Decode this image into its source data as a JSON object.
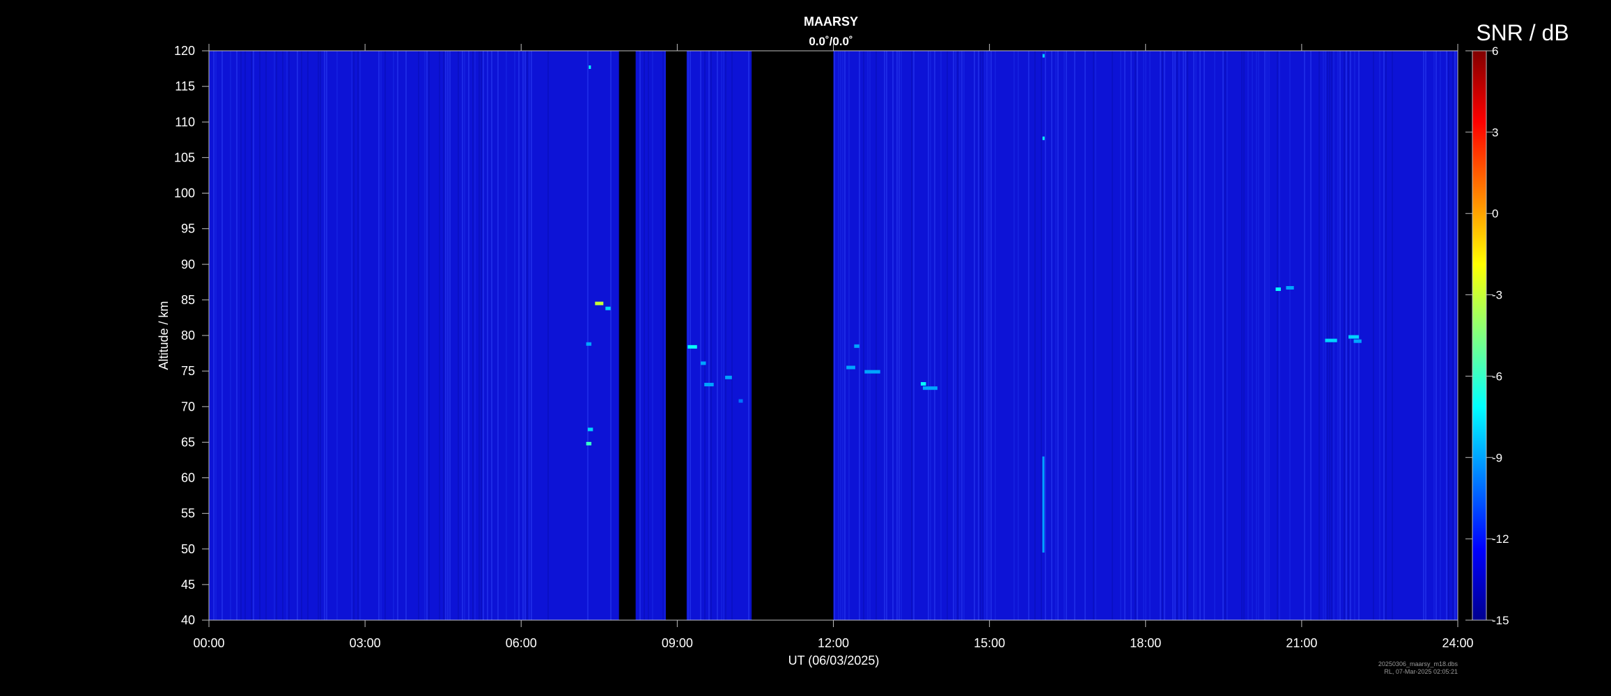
{
  "chart_data": {
    "type": "heatmap",
    "title": "MAARSY",
    "subtitle": "0.0˚/0.0˚",
    "xlabel": "UT (06/03/2025)",
    "ylabel": "Altitude / km",
    "x_range_hours": [
      0,
      24
    ],
    "x_ticks": [
      {
        "hour": 0,
        "label": "00:00"
      },
      {
        "hour": 3,
        "label": "03:00"
      },
      {
        "hour": 6,
        "label": "06:00"
      },
      {
        "hour": 9,
        "label": "09:00"
      },
      {
        "hour": 12,
        "label": "12:00"
      },
      {
        "hour": 15,
        "label": "15:00"
      },
      {
        "hour": 18,
        "label": "18:00"
      },
      {
        "hour": 21,
        "label": "21:00"
      },
      {
        "hour": 24,
        "label": "24:00"
      }
    ],
    "y_range": [
      40,
      120
    ],
    "y_ticks": [
      40,
      45,
      50,
      55,
      60,
      65,
      70,
      75,
      80,
      85,
      90,
      95,
      100,
      105,
      110,
      115,
      120
    ],
    "colorbar": {
      "title": "SNR / dB",
      "range": [
        -15,
        6
      ],
      "ticks": [
        6,
        3,
        0,
        -3,
        -6,
        -9,
        -12,
        -15
      ],
      "colormap": "jet"
    },
    "background_snr_db": -13.5,
    "data_gaps_hours": [
      [
        7.88,
        8.2
      ],
      [
        8.78,
        9.18
      ],
      [
        10.43,
        12.0
      ]
    ],
    "echoes": [
      {
        "t_start": 7.42,
        "t_end": 7.58,
        "alt": 84.5,
        "snr": -3
      },
      {
        "t_start": 7.62,
        "t_end": 7.72,
        "alt": 83.8,
        "snr": -8
      },
      {
        "t_start": 7.25,
        "t_end": 7.35,
        "alt": 78.8,
        "snr": -9
      },
      {
        "t_start": 7.28,
        "t_end": 7.38,
        "alt": 66.8,
        "snr": -8
      },
      {
        "t_start": 7.25,
        "t_end": 7.35,
        "alt": 64.8,
        "snr": -6
      },
      {
        "t_start": 7.3,
        "t_end": 7.34,
        "alt": 117.7,
        "snr": -7
      },
      {
        "t_start": 9.2,
        "t_end": 9.38,
        "alt": 78.4,
        "snr": -7
      },
      {
        "t_start": 9.45,
        "t_end": 9.55,
        "alt": 76.1,
        "snr": -9
      },
      {
        "t_start": 9.52,
        "t_end": 9.7,
        "alt": 73.1,
        "snr": -9
      },
      {
        "t_start": 9.92,
        "t_end": 10.05,
        "alt": 74.1,
        "snr": -9
      },
      {
        "t_start": 10.18,
        "t_end": 10.26,
        "alt": 70.8,
        "snr": -10
      },
      {
        "t_start": 12.4,
        "t_end": 12.5,
        "alt": 78.5,
        "snr": -9
      },
      {
        "t_start": 12.25,
        "t_end": 12.42,
        "alt": 75.5,
        "snr": -9
      },
      {
        "t_start": 12.6,
        "t_end": 12.9,
        "alt": 74.9,
        "snr": -9
      },
      {
        "t_start": 13.68,
        "t_end": 13.78,
        "alt": 73.2,
        "snr": -7
      },
      {
        "t_start": 13.72,
        "t_end": 14.0,
        "alt": 72.6,
        "snr": -9
      },
      {
        "t_start": 16.02,
        "t_end": 16.05,
        "alt": 107.7,
        "snr": -7
      },
      {
        "t_start": 16.02,
        "t_end": 16.05,
        "alt": 119.3,
        "snr": -8
      },
      {
        "t_start": 20.5,
        "t_end": 20.6,
        "alt": 86.5,
        "snr": -7
      },
      {
        "t_start": 20.7,
        "t_end": 20.85,
        "alt": 86.7,
        "snr": -9
      },
      {
        "t_start": 21.45,
        "t_end": 21.68,
        "alt": 79.3,
        "snr": -8
      },
      {
        "t_start": 21.9,
        "t_end": 22.1,
        "alt": 79.8,
        "snr": -8
      },
      {
        "t_start": 22.0,
        "t_end": 22.15,
        "alt": 79.2,
        "snr": -9
      }
    ],
    "vertical_streaks": [
      {
        "t": 16.03,
        "alt_start": 49.5,
        "alt_end": 63,
        "snr": -9
      }
    ],
    "footer": [
      "20250306_maarsy_m18.dbs",
      "RL, 07-Mar-2025 02:05:21"
    ]
  }
}
